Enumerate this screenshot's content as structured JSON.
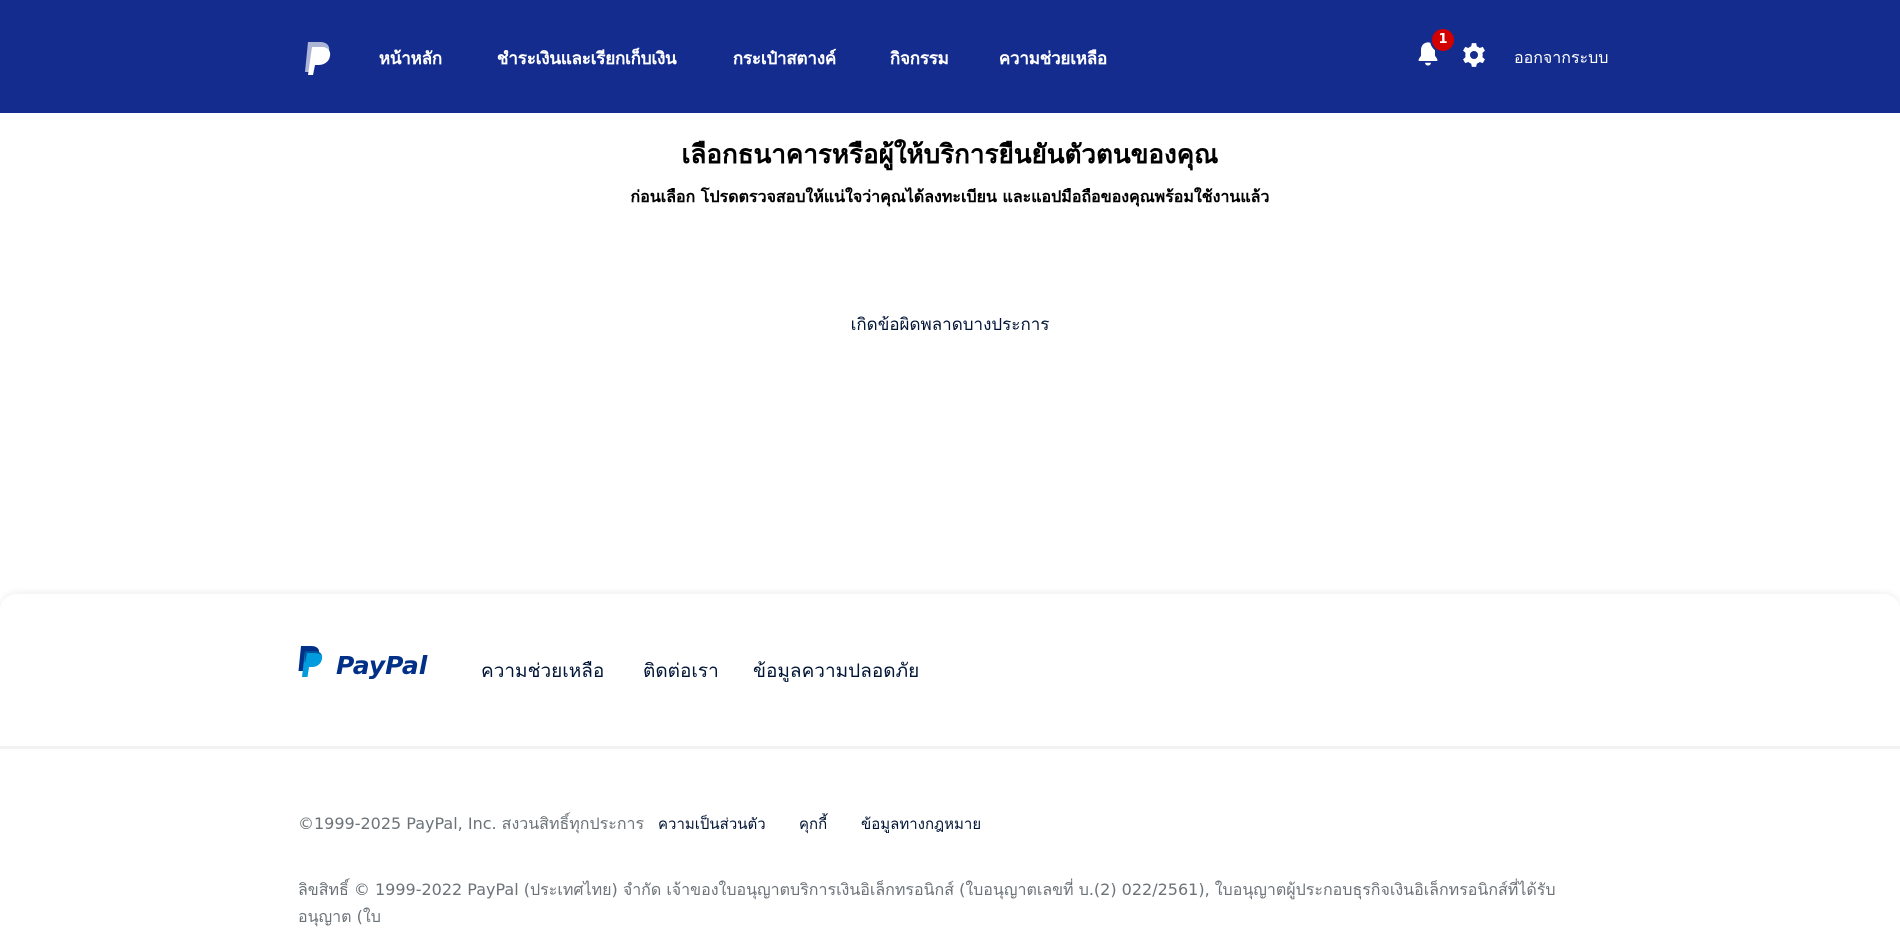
{
  "header": {
    "nav": [
      {
        "label": "หน้าหลัก"
      },
      {
        "label": "ชำระเงินและเรียกเก็บเงิน"
      },
      {
        "label": "กระเป๋าสตางค์"
      },
      {
        "label": "กิจกรรม"
      },
      {
        "label": "ความช่วยเหลือ"
      }
    ],
    "notification_count": "1",
    "logout_label": "ออกจากระบบ",
    "icons": [
      "paypal-logo",
      "bell-icon",
      "gear-icon"
    ]
  },
  "main": {
    "title": "เลือกธนาคารหรือผู้ให้บริการยืนยันตัวตนของคุณ",
    "subtitle": "ก่อนเลือก โปรดตรวจสอบให้แน่ใจว่าคุณได้ลงทะเบียน และแอปมือถือของคุณพร้อมใช้งานแล้ว",
    "error_message": "เกิดข้อผิดพลาดบางประการ"
  },
  "footer": {
    "brand": "PayPal",
    "links": [
      {
        "label": "ความช่วยเหลือ"
      },
      {
        "label": "ติดต่อเรา"
      },
      {
        "label": "ข้อมูลความปลอดภัย"
      }
    ],
    "copyright": "©1999-2025 PayPal, Inc. สงวนสิทธิ์ทุกประการ",
    "legal_links": [
      {
        "label": "ความเป็นส่วนตัว"
      },
      {
        "label": "คุกกี้"
      },
      {
        "label": "ข้อมูลทางกฎหมาย"
      }
    ],
    "legal_text": "ลิขสิทธิ์ © 1999-2022 PayPal (ประเทศไทย) จำกัด เจ้าของใบอนุญาตบริการเงินอิเล็กทรอนิกส์ (ใบอนุญาตเลขที่ บ.(2) 022/2561), ใบอนุญาตผู้ประกอบธุรกิจเงินอิเล็กทรอนิกส์ที่ได้รับอนุญาต (ใบ"
  },
  "colors": {
    "header_bg": "#142c8e",
    "badge": "#d20000",
    "text_dark": "#001435",
    "text_muted": "#6c7378",
    "paypal_dark_blue": "#003087",
    "paypal_light_blue": "#009cde"
  }
}
